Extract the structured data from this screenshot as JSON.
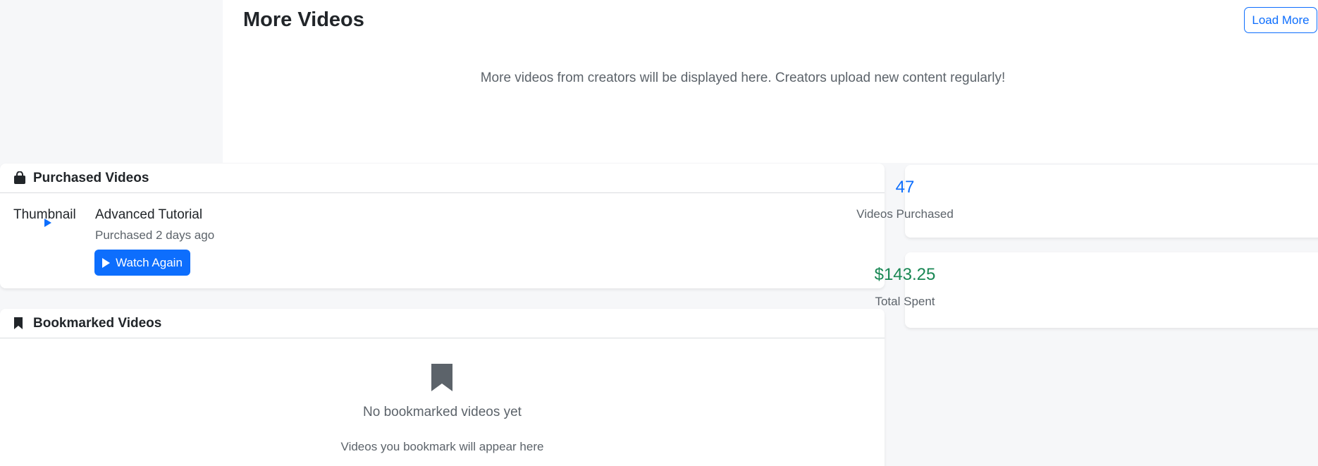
{
  "more_videos": {
    "title": "More Videos",
    "load_more_label": "Load More",
    "description": "More videos from creators will be displayed here. Creators upload new content regularly!"
  },
  "purchased": {
    "header": "Purchased Videos",
    "header_icon": "shopping-bag-icon",
    "items": [
      {
        "thumbnail_alt": "Thumbnail",
        "title": "Advanced Tutorial",
        "meta": "Purchased 2 days ago",
        "action_label": "Watch Again"
      }
    ]
  },
  "bookmarked": {
    "header": "Bookmarked Videos",
    "header_icon": "bookmark-icon",
    "empty_title": "No bookmarked videos yet",
    "empty_subtitle": "Videos you bookmark will appear here"
  },
  "stats": [
    {
      "value": "47",
      "label": "Videos Purchased",
      "color": "#0d6efd"
    },
    {
      "value": "$143.25",
      "label": "Total Spent",
      "color": "#198754"
    }
  ],
  "colors": {
    "primary": "#0d6efd",
    "success": "#198754",
    "muted_text": "#5c636a",
    "page_bg": "#f6f7f9"
  }
}
